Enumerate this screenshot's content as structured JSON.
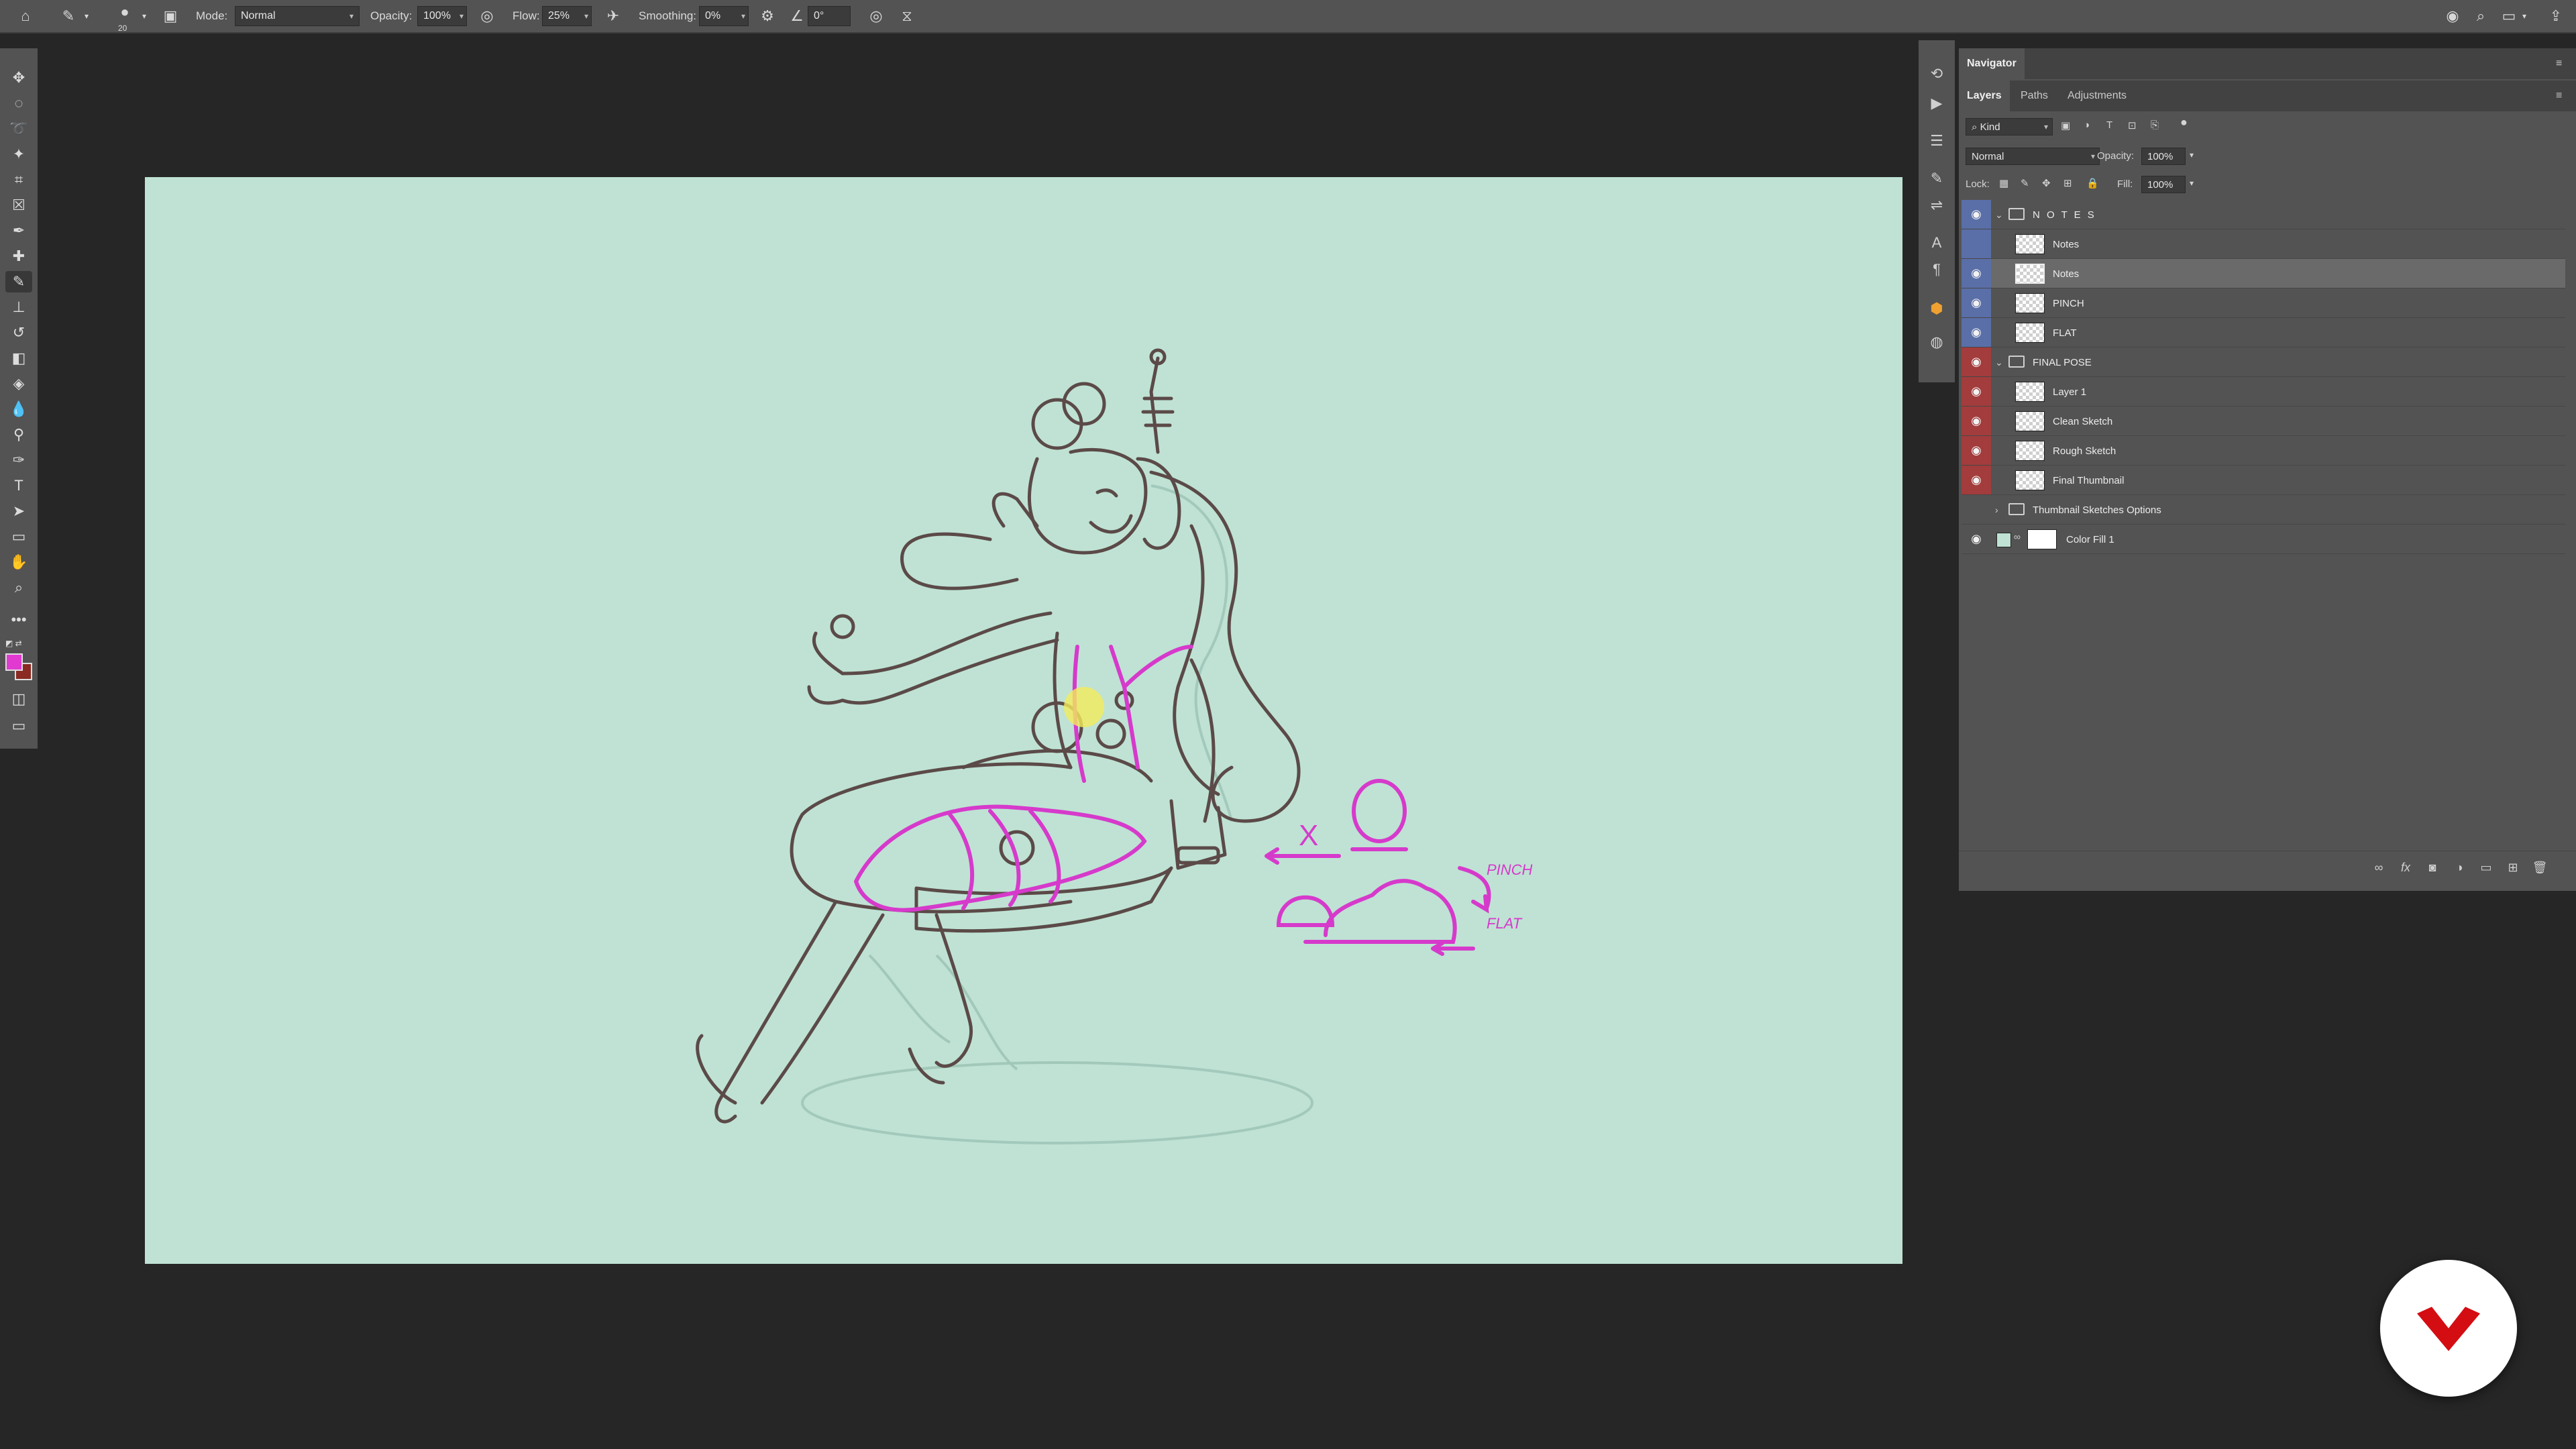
{
  "options_bar": {
    "home_icon": "home-icon",
    "tool_icon": "brush-icon",
    "brush_size": "20",
    "mode_label": "Mode:",
    "mode_value": "Normal",
    "opacity_label": "Opacity:",
    "opacity_value": "100%",
    "flow_label": "Flow:",
    "flow_value": "25%",
    "smoothing_label": "Smoothing:",
    "smoothing_value": "0%",
    "angle_value": "0°"
  },
  "toolbar": {
    "tools": [
      "move",
      "marquee",
      "lasso",
      "magic-wand",
      "crop",
      "frame",
      "eyedropper",
      "healing",
      "brush",
      "stamp",
      "history-brush",
      "eraser",
      "gradient",
      "blur",
      "dodge",
      "pen",
      "type",
      "path-select",
      "rectangle",
      "hand",
      "zoom",
      "more"
    ],
    "active_tool": "brush",
    "foreground_color": "#e03ad0",
    "background_color": "#8a2a22"
  },
  "panels": {
    "navigator_title": "Navigator",
    "tabs": [
      "Layers",
      "Paths",
      "Adjustments"
    ],
    "active_tab": "Layers",
    "filter_kind": "Kind",
    "blend_mode": "Normal",
    "opacity_label": "Opacity:",
    "opacity_value": "100%",
    "lock_label": "Lock:",
    "fill_label": "Fill:",
    "fill_value": "100%",
    "layers": [
      {
        "name": "N O T E S",
        "type": "group",
        "color": "#5a6fa8"
      },
      {
        "name": "Notes",
        "type": "layer",
        "color": "#5a6fa8",
        "visible": false
      },
      {
        "name": "Notes",
        "type": "layer",
        "color": "#5a6fa8",
        "selected": true
      },
      {
        "name": "PINCH",
        "type": "layer",
        "color": "#5a6fa8"
      },
      {
        "name": "FLAT",
        "type": "layer",
        "color": "#5a6fa8"
      },
      {
        "name": "FINAL POSE",
        "type": "group",
        "color": "#a33c3c"
      },
      {
        "name": "Layer 1",
        "type": "layer",
        "color": "#a33c3c"
      },
      {
        "name": "Clean Sketch",
        "type": "layer",
        "color": "#a33c3c"
      },
      {
        "name": "Rough Sketch",
        "type": "layer",
        "color": "#a33c3c"
      },
      {
        "name": "Final Thumbnail",
        "type": "layer",
        "color": "#a33c3c"
      },
      {
        "name": "Thumbnail Sketches Options",
        "type": "group-collapsed",
        "color": null,
        "visible": false
      },
      {
        "name": "Color Fill 1",
        "type": "fill",
        "color": null
      }
    ]
  },
  "canvas": {
    "background": "#bfe2d4",
    "annotations": {
      "pinch": "PINCH",
      "flat": "FLAT",
      "x_mark": "X"
    }
  },
  "colors": {
    "app_bg": "#262626",
    "panel_bg": "#535353",
    "sketch_pink": "#d63acb",
    "sketch_line": "#5b4a48"
  }
}
